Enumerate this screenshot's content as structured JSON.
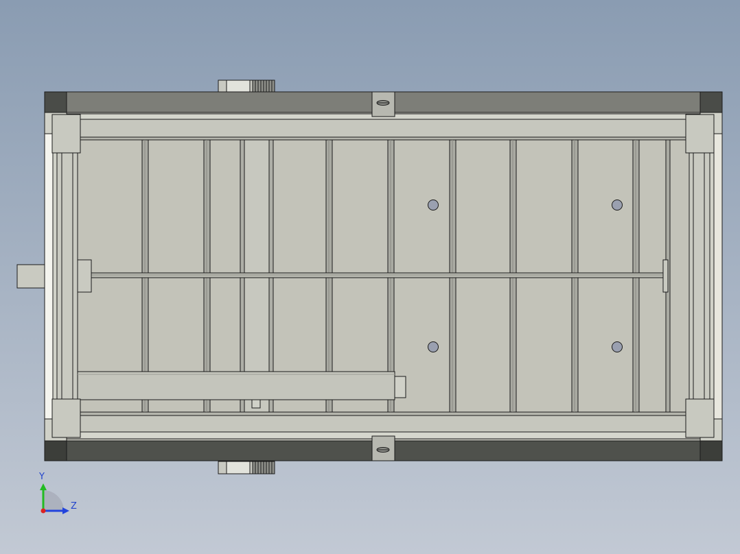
{
  "triad": {
    "y_label": "Y",
    "z_label": "Z",
    "icons": [
      "y-axis-arrow-icon",
      "z-axis-arrow-icon",
      "origin-icon"
    ]
  },
  "colors": {
    "background_top": "#8a9cb2",
    "background_bottom": "#c2c9d4",
    "frame_dark": "#4a4c48",
    "rail_gray": "#7d7e78",
    "panel_fill": "#c3c3b9",
    "bracket_fill": "#c8c9c0",
    "hole_fill": "#9aa0b0",
    "axis_y": "#22bb22",
    "axis_z": "#2244dd",
    "axis_x": "#dd2222"
  }
}
